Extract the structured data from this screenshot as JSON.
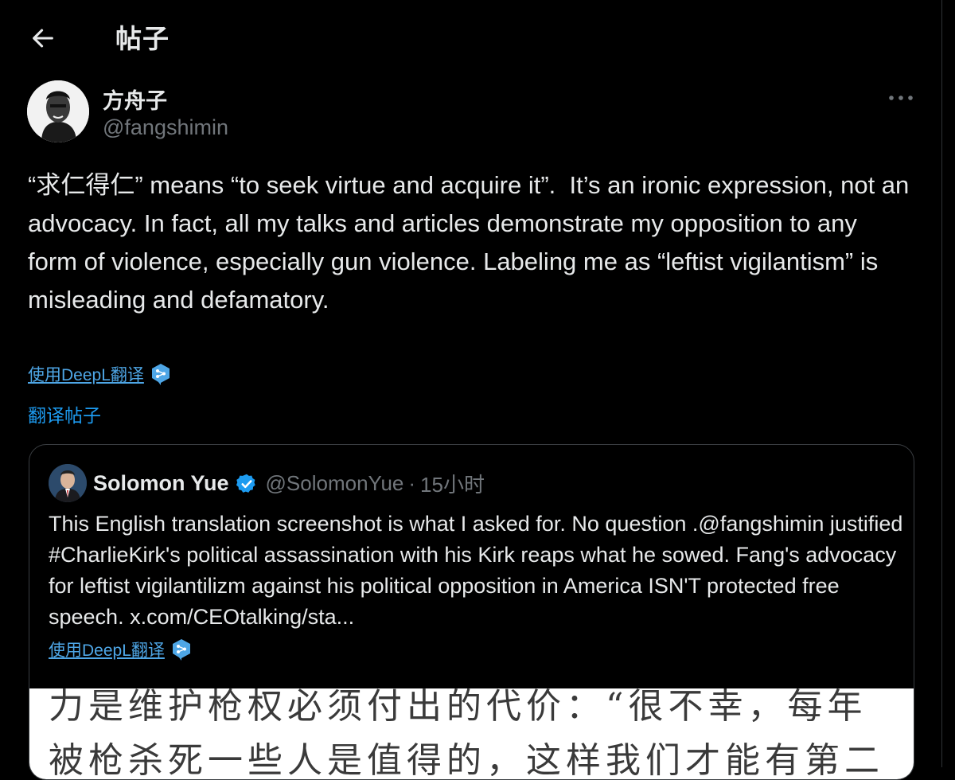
{
  "header": {
    "title": "帖子",
    "back_icon": "arrow-left-icon"
  },
  "post": {
    "author_name": "方舟子",
    "author_handle": "@fangshimin",
    "more_icon": "more-horizontal-icon",
    "text": "“求仁得仁” means “to seek virtue and acquire it”.  It’s an ironic expression, not an advocacy. In fact, all my talks and articles demonstrate my opposition to any form of violence, especially gun violence. Labeling me as “leftist vigilantism” is misleading and defamatory.",
    "deepl_label": "使用DeepL翻译",
    "translate_label": "翻译帖子"
  },
  "quote": {
    "name": "Solomon Yue",
    "handle": "@SolomonYue",
    "separator": "·",
    "time": "15小时",
    "text": "This English translation screenshot is what I asked for. No question .@fangshimin justified #CharlieKirk's political assassination with his Kirk reaps what he sowed. Fang's advocacy for leftist vigilantilizm against his political opposition in America ISN'T protected free speech.  x.com/CEOtalking/sta...",
    "deepl_label": "使用DeepL翻译",
    "image_lines": [
      "力是维护枪权必须付出的代价：“很不幸，每年",
      "被枪杀死一些人是值得的，这样我们才能有第二"
    ]
  },
  "colors": {
    "background": "#000000",
    "text": "#e7e9ea",
    "muted": "#71767b",
    "link": "#1d9bf0",
    "deepl": "#4ea6e6",
    "verified": "#1d9bf0"
  }
}
